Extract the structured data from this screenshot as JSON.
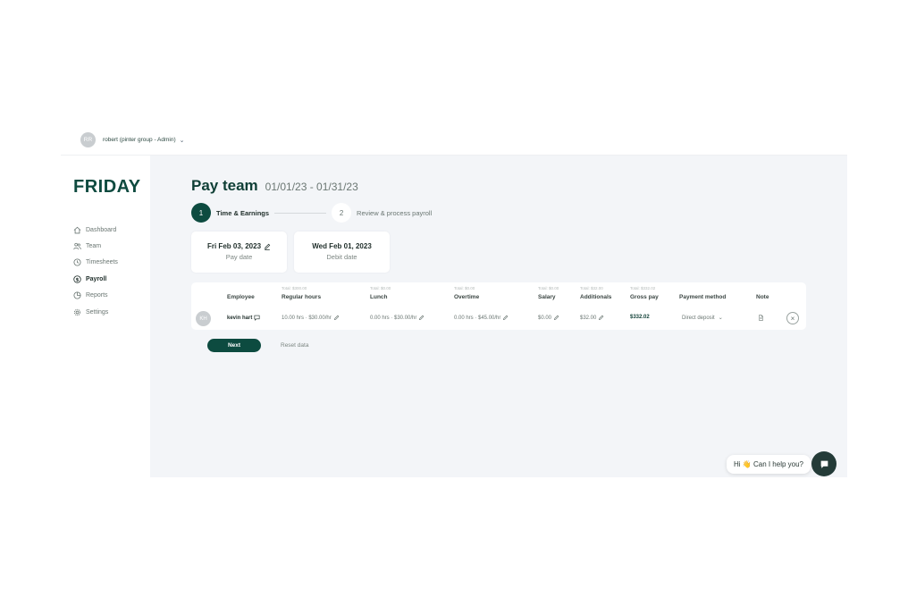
{
  "user": {
    "initials": "RR",
    "label": "robert (pinter group - Admin)"
  },
  "logo": "FRIDAY",
  "nav": [
    {
      "label": "Dashboard",
      "icon": "home-icon"
    },
    {
      "label": "Team",
      "icon": "team-icon"
    },
    {
      "label": "Timesheets",
      "icon": "clock-icon"
    },
    {
      "label": "Payroll",
      "icon": "dollar-icon",
      "active": true
    },
    {
      "label": "Reports",
      "icon": "pie-chart-icon"
    },
    {
      "label": "Settings",
      "icon": "gear-icon"
    }
  ],
  "page": {
    "title": "Pay team",
    "range": "01/01/23 - 01/31/23"
  },
  "steps": [
    {
      "num": "1",
      "label": "Time & Earnings",
      "active": true
    },
    {
      "num": "2",
      "label": "Review & process payroll",
      "active": false
    }
  ],
  "cards": {
    "pay_date": {
      "value": "Fri Feb 03, 2023",
      "label": "Pay date"
    },
    "debit_date": {
      "value": "Wed Feb 01, 2023",
      "label": "Debit date"
    }
  },
  "table": {
    "headers": {
      "employee": "Employee",
      "regular": {
        "total": "Total: $300.00",
        "label": "Regular hours"
      },
      "lunch": {
        "total": "Total: $0.00",
        "label": "Lunch"
      },
      "overtime": {
        "total": "Total: $0.00",
        "label": "Overtime"
      },
      "salary": {
        "total": "Total: $0.00",
        "label": "Salary"
      },
      "additionals": {
        "total": "Total: $32.00",
        "label": "Additionals"
      },
      "gross": {
        "total": "Total: $332.02",
        "label": "Gross pay"
      },
      "payment": "Payment method",
      "note": "Note"
    },
    "row": {
      "initials": "KH",
      "name": "kevin hart",
      "regular": "10.00 hrs · $30.00/hr",
      "lunch": "0.00 hrs · $30.00/hr",
      "overtime": "0.00 hrs · $45.00/hr",
      "salary": "$0.00",
      "additionals": "$32.00",
      "gross": "$332.02",
      "payment": "Direct deposit"
    }
  },
  "actions": {
    "next": "Next",
    "reset": "Reset data"
  },
  "chat": {
    "greeting": "Hi 👋 Can I help you?"
  },
  "colors": {
    "brand": "#0d4b40",
    "background": "#f3f5f8"
  }
}
